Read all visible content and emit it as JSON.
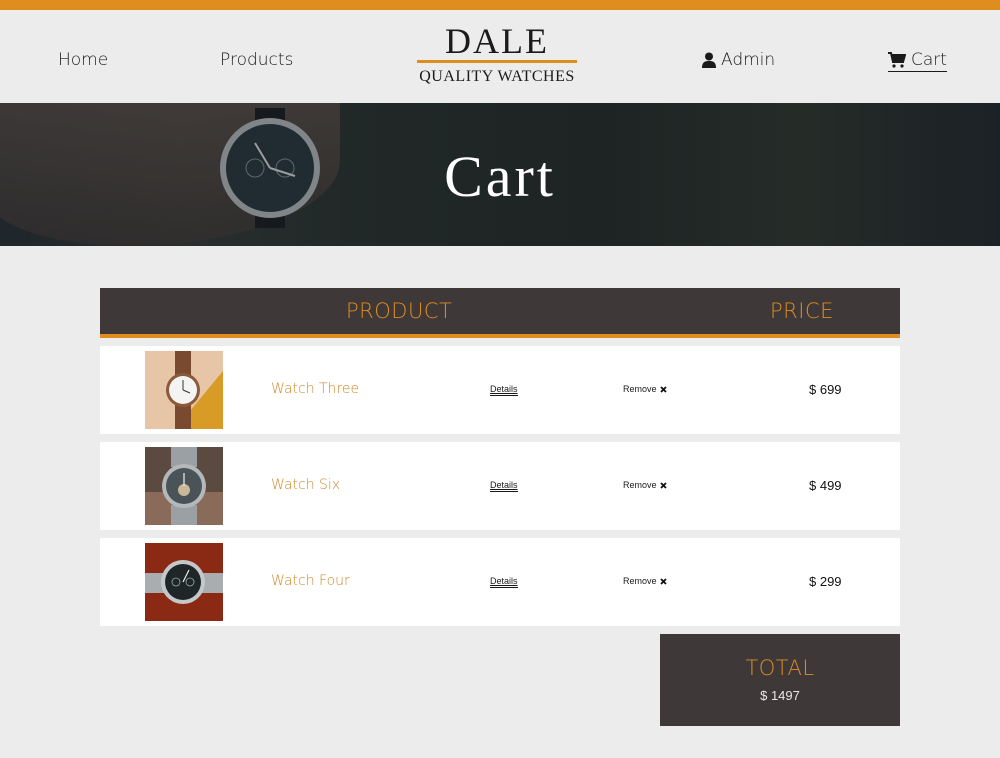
{
  "nav": {
    "home": "Home",
    "products": "Products",
    "admin": "Admin",
    "cart": "Cart"
  },
  "brand": {
    "name": "DALE",
    "tagline": "QUALITY WATCHES"
  },
  "hero": {
    "title": "Cart"
  },
  "table": {
    "header_product": "PRODUCT",
    "header_price": "PRICE",
    "rows": [
      {
        "title": "Watch Three",
        "details": "Details",
        "remove": "Remove",
        "price": "$ 699"
      },
      {
        "title": "Watch Six",
        "details": "Details",
        "remove": "Remove",
        "price": "$ 499"
      },
      {
        "title": "Watch Four",
        "details": "Details",
        "remove": "Remove",
        "price": "$ 299"
      }
    ]
  },
  "total": {
    "label": "TOTAL",
    "amount": "$ 1497"
  },
  "colors": {
    "accent": "#df8d1f",
    "dark_panel": "#3e3838",
    "page_bg": "#ececec",
    "product_title": "#d08a2a"
  },
  "icons": {
    "admin": "user-icon",
    "cart": "shopping-cart-icon",
    "remove": "close-icon"
  }
}
